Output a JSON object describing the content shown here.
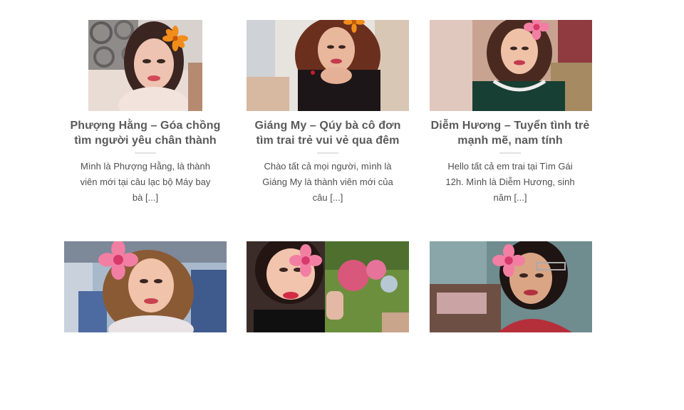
{
  "posts": [
    {
      "title_line1": "Phượng Hằng – Góa chồng",
      "title_line2": "tìm người yêu chân thành",
      "excerpt_line1": "Mình là Phượng Hằng, là thành",
      "excerpt_line2": "viên mới tại câu lạc bộ Máy bay",
      "excerpt_line3": "bà",
      "more": "[...]"
    },
    {
      "title_line1": "Giáng My – Qúy bà cô đơn",
      "title_line2": "tìm trai trẻ vui vẻ qua đêm",
      "excerpt_line1": "Chào tất cả mọi người, mình là",
      "excerpt_line2": "Giáng My là thành viên mới của",
      "excerpt_line3": "câu",
      "more": "[...]"
    },
    {
      "title_line1": "Diễm Hương – Tuyển tình trẻ",
      "title_line2": "mạnh mẽ, nam tính",
      "excerpt_line1": "Hello tất cả em trai tại Tìm Gái",
      "excerpt_line2": "12h. Mình là Diễm Hương, sinh",
      "excerpt_line3": "năm",
      "more": "[...]"
    },
    {},
    {},
    {}
  ],
  "colors": {
    "title": "#5a5a5a",
    "text": "#4f4f4f",
    "divider": "#e2e2e2",
    "flower_pink": "#f27fa3",
    "flower_orange": "#f28c1a"
  },
  "icons": [
    "flower-sticker-icon"
  ]
}
